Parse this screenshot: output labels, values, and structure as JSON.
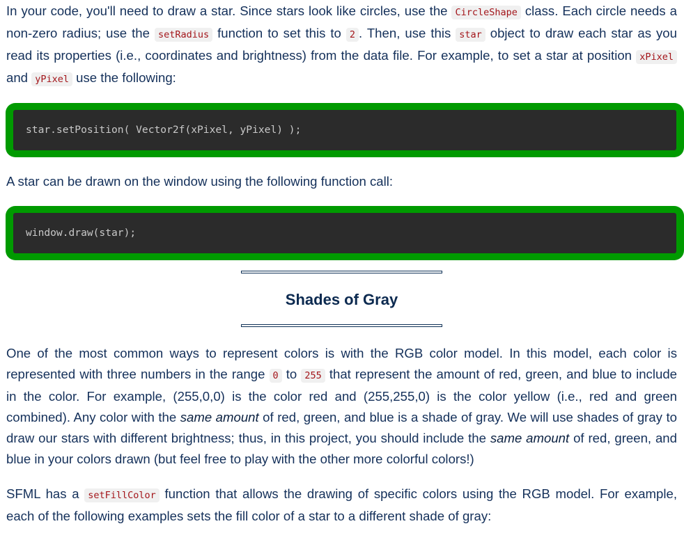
{
  "intro_paragraph": {
    "t1": "In your code, you'll need to draw a star. Since stars look like circles, use the ",
    "c1": "CircleShape",
    "t2": " class. Each circle needs a non-zero radius; use the ",
    "c2": "setRadius",
    "t3": " function to set this to ",
    "c3": "2",
    "t4": ". Then, use this ",
    "c4": "star",
    "t5": " object to draw each star as you read its properties (i.e., coordinates and brightness) from the data file. For example, to set a star at position ",
    "c5": "xPixel",
    "t6": " and ",
    "c6": "yPixel",
    "t7": " use the following:"
  },
  "code_block_1": "star.setPosition( Vector2f(xPixel, yPixel) );",
  "draw_paragraph": "A star can be drawn on the window using the following function call:",
  "code_block_2": "window.draw(star);",
  "section_heading": "Shades of Gray",
  "rgb_paragraph": {
    "t1": "One of the most common ways to represent colors is with the RGB color model. In this model, each color is represented with three numbers in the range ",
    "c1": "0",
    "t2": " to ",
    "c2": "255",
    "t3": " that represent the amount of red, green, and blue to include in the color. For example, (255,0,0) is the color red and (255,255,0) is the color yellow (i.e., red and green combined). Any color with the ",
    "e1": "same amount",
    "t4": " of red, green, and blue is a shade of gray. We will use shades of gray to draw our stars with different brightness; thus, in this project, you should include the ",
    "e2": "same amount",
    "t5": " of red, green, and blue in your colors drawn (but feel free to play with the other more colorful colors!)"
  },
  "sfml_paragraph": {
    "t1": "SFML has a ",
    "c1": "setFillColor",
    "t2": " function that allows the drawing of specific colors using the RGB model. For example, each of the following examples sets the fill color of a star to a different shade of gray:"
  },
  "colors": {
    "text": "#14305a",
    "code_border": "#009a00",
    "code_bg": "#2b2b2b",
    "inline_code_text": "#a3151a",
    "rule": "#0c2f55"
  }
}
